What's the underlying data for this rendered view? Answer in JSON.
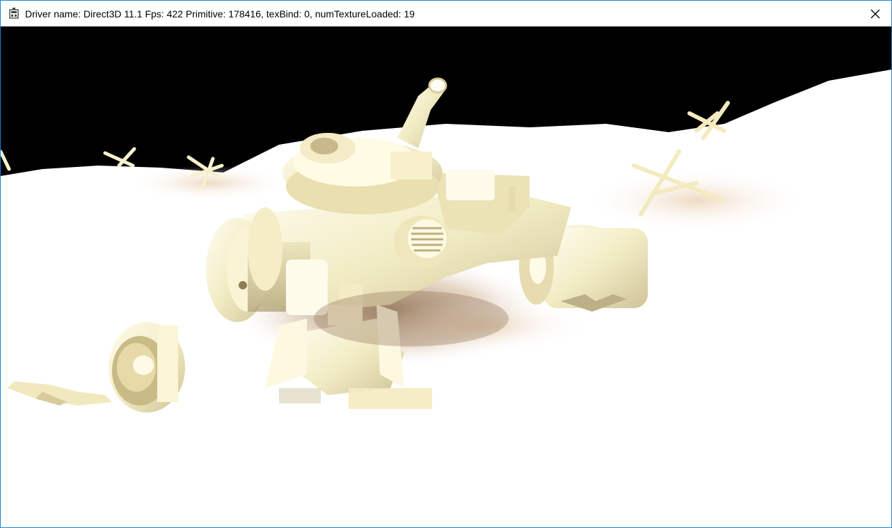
{
  "window": {
    "title": "Driver name: Direct3D 11.1 Fps: 422 Primitive: 178416, texBind: 0, numTextureLoaded: 19",
    "app_icon": "app-icon",
    "close_icon": "close-icon"
  },
  "colors": {
    "sky": "#000000",
    "ground": "#ffffff",
    "model_tint": "#f1ecc6",
    "shadow": "#c9b08f",
    "border": "#1883d7"
  }
}
